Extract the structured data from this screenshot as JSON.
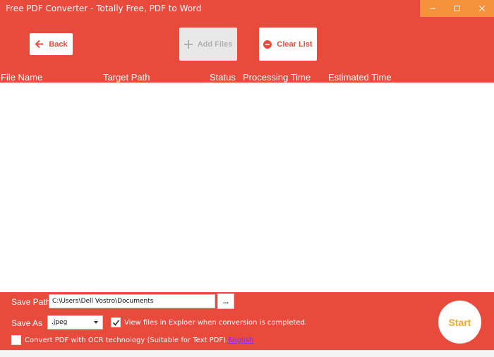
{
  "window": {
    "title": "Free PDF Converter - Totally Free, PDF to Word",
    "controls": [
      "minimize-icon",
      "maximize-icon",
      "close-icon"
    ]
  },
  "toolbar": {
    "back_label": "Back",
    "add_files_label": "Add Files",
    "clear_list_label": "Clear List"
  },
  "table": {
    "columns": [
      "File Name",
      "Target Path",
      "Status",
      "Processing Time",
      "Estimated Time"
    ],
    "rows": []
  },
  "bottom": {
    "save_path_label": "Save Path",
    "save_path_value": "C:\\Users\\Dell Vostro\\Documents",
    "browse_label": "...",
    "save_as_label": "Save As",
    "save_as_value": ".jpeg",
    "view_files_label": "View files in Exploer when conversion is completed.",
    "view_files_checked": true,
    "ocr_label": "Convert PDF with OCR technology (Suitable for Text PDF).",
    "ocr_checked": false,
    "language_link": "English",
    "start_label": "Start"
  },
  "colors": {
    "primary": "#e84a3c",
    "window_controls": "#f5913a",
    "start_text": "#f5a623",
    "link": "#8a2be2"
  }
}
